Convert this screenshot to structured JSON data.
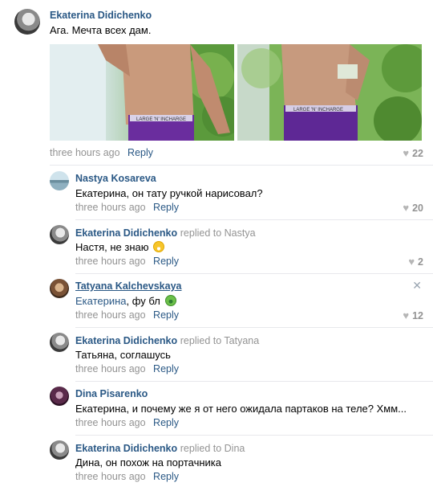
{
  "top": {
    "author": "Ekaterina Didichenko",
    "text": "Ага. Мечта всех дам.",
    "time": "three hours ago",
    "reply": "Reply",
    "likes": "22"
  },
  "replies": [
    {
      "author": "Nastya Kosareva",
      "replied_to": "",
      "text": "Екатерина, он тату ручкой нарисовал?",
      "time": "three hours ago",
      "reply": "Reply",
      "likes": "20"
    },
    {
      "author": "Ekaterina Didichenko",
      "replied_to": "replied to Nastya",
      "text": "Настя, не знаю",
      "time": "three hours ago",
      "reply": "Reply",
      "likes": "2"
    },
    {
      "author": "Tatyana Kalchevskaya",
      "replied_to": "",
      "text_link": "Екатерина",
      "text_rest": ", фу бл",
      "time": "three hours ago",
      "reply": "Reply",
      "likes": "12"
    },
    {
      "author": "Ekaterina Didichenko",
      "replied_to": "replied to Tatyana",
      "text": "Татьяна, соглашусь",
      "time": "three hours ago",
      "reply": "Reply"
    },
    {
      "author": "Dina Pisarenko",
      "replied_to": "",
      "text": "Екатерина, и почему же я от него ожидала партаков на теле? Хмм...",
      "time": "three hours ago",
      "reply": "Reply"
    },
    {
      "author": "Ekaterina Didichenko",
      "replied_to": "replied to Dina",
      "text": "Дина, он похож на портачника",
      "time": "three hours ago",
      "reply": "Reply"
    }
  ],
  "photos": {
    "left_caption": "LARGE 'N' INCHARGE",
    "right_caption": "LARGE 'N' INCHARGE"
  },
  "icons": {
    "heart": "heart-icon",
    "close": "close-icon"
  },
  "colors": {
    "link": "#2a5885",
    "meta": "#939393",
    "separator": "#e7e8ec"
  }
}
